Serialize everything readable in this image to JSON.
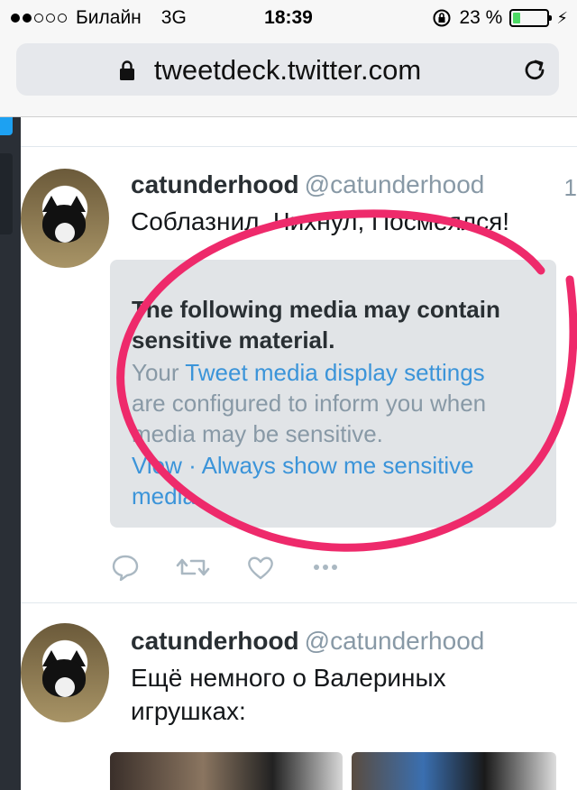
{
  "status_bar": {
    "carrier": "Билайн",
    "network": "3G",
    "time": "18:39",
    "battery_percent": "23 %",
    "battery_level": 0.23,
    "signal_bars_filled": 2,
    "signal_bars_total": 5
  },
  "address_bar": {
    "url": "tweetdeck.twitter.com",
    "lock_icon": "lock-icon",
    "reload_icon": "reload-icon"
  },
  "tweets": [
    {
      "display_name": "catunderhood",
      "handle": "@catunderhood",
      "time": "1",
      "text": "Соблазнил, Чихнул, Посмеялся!",
      "sensitive": {
        "title_line1": "The following media may contain",
        "title_line2": "sensitive material.",
        "body_prefix": "Your ",
        "body_link": "Tweet media display settings",
        "body_line2": "are configured to inform you when",
        "body_line3": "media may be sensitive.",
        "view_link": "View",
        "separator": " · ",
        "always_link_line1": "Always show me sensitive",
        "always_link_line2": "media"
      },
      "actions": [
        "reply-icon",
        "retweet-icon",
        "like-icon",
        "more-icon"
      ]
    },
    {
      "display_name": "catunderhood",
      "handle": "@catunderhood",
      "text_line1": "Ещё немного о Валериных",
      "text_line2": "игрушках:"
    }
  ],
  "colors": {
    "accent": "#1da1f2",
    "link": "#3b94d9",
    "annotation": "#ee2a6b",
    "battery": "#4cd964"
  }
}
